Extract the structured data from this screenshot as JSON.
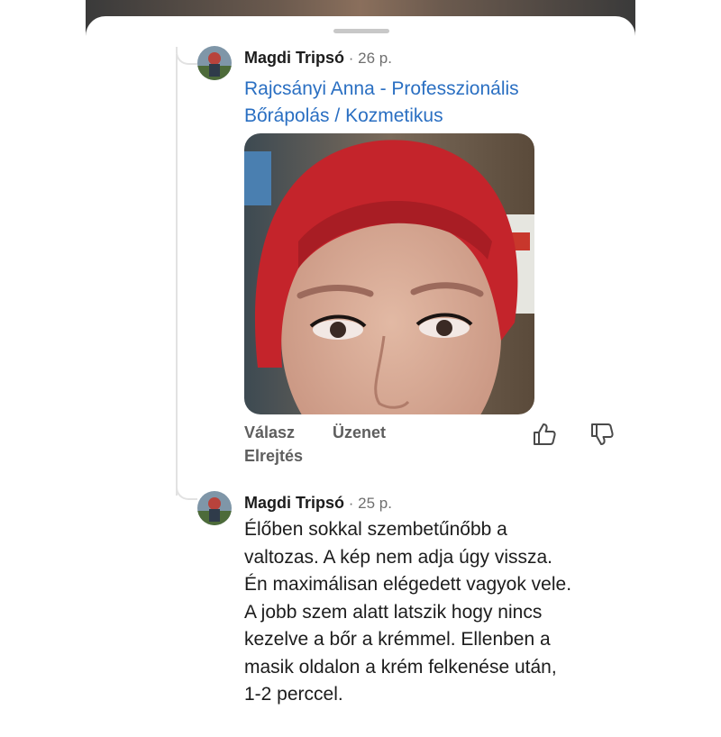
{
  "comments": [
    {
      "author": "Magdi Tripsó",
      "time": " · 26 p.",
      "mention": "Rajcsányi Anna - Professzionális Bőrápolás / Kozmetikus",
      "actions": {
        "reply": "Válasz",
        "message": "Üzenet",
        "hide": "Elrejtés"
      }
    },
    {
      "author": "Magdi Tripsó",
      "time": " · 25 p.",
      "lines": [
        "Élőben sokkal szembetűnőbb a",
        "valtozas. A kép nem adja úgy vissza.",
        "Én maximálisan elégedett vagyok vele.",
        "A jobb szem alatt latszik hogy  nincs",
        "kezelve a bőr a krémmel. Ellenben a",
        "masik oldalon a krém felkenése után,",
        "1-2 perccel."
      ]
    }
  ],
  "icons": {
    "like": "thumbs-up-icon",
    "dislike": "thumbs-down-icon"
  },
  "colors": {
    "mention": "#2a6fc2",
    "text": "#1c1c1c",
    "muted": "#6f6f6f"
  }
}
